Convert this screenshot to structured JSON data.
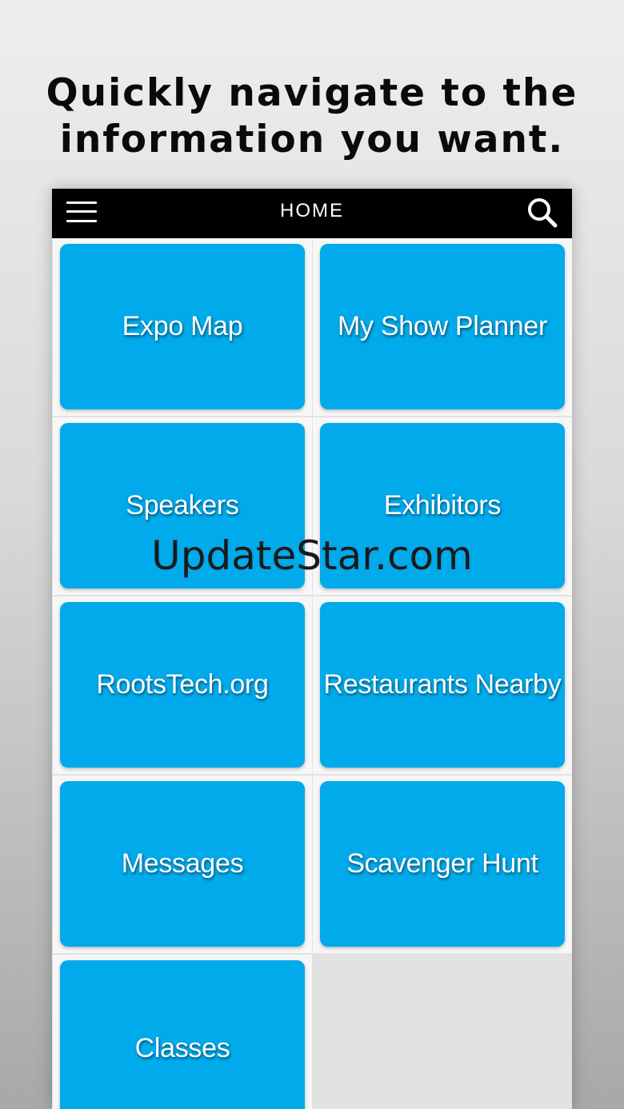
{
  "headline": {
    "line1": "Quickly navigate to the",
    "line2": "information you want."
  },
  "topbar": {
    "title": "HOME",
    "menu_icon": "hamburger-menu-icon",
    "search_icon": "search-icon"
  },
  "tiles": [
    {
      "label": "Expo Map"
    },
    {
      "label": "My Show Planner"
    },
    {
      "label": "Speakers"
    },
    {
      "label": "Exhibitors"
    },
    {
      "label": "RootsTech.org"
    },
    {
      "label": "Restaurants Nearby"
    },
    {
      "label": "Messages"
    },
    {
      "label": "Scavenger Hunt"
    },
    {
      "label": "Classes"
    }
  ],
  "watermark": "UpdateStar.com",
  "colors": {
    "tile": "#00aaeb",
    "topbar": "#000000",
    "tile_text": "#ffffff"
  }
}
